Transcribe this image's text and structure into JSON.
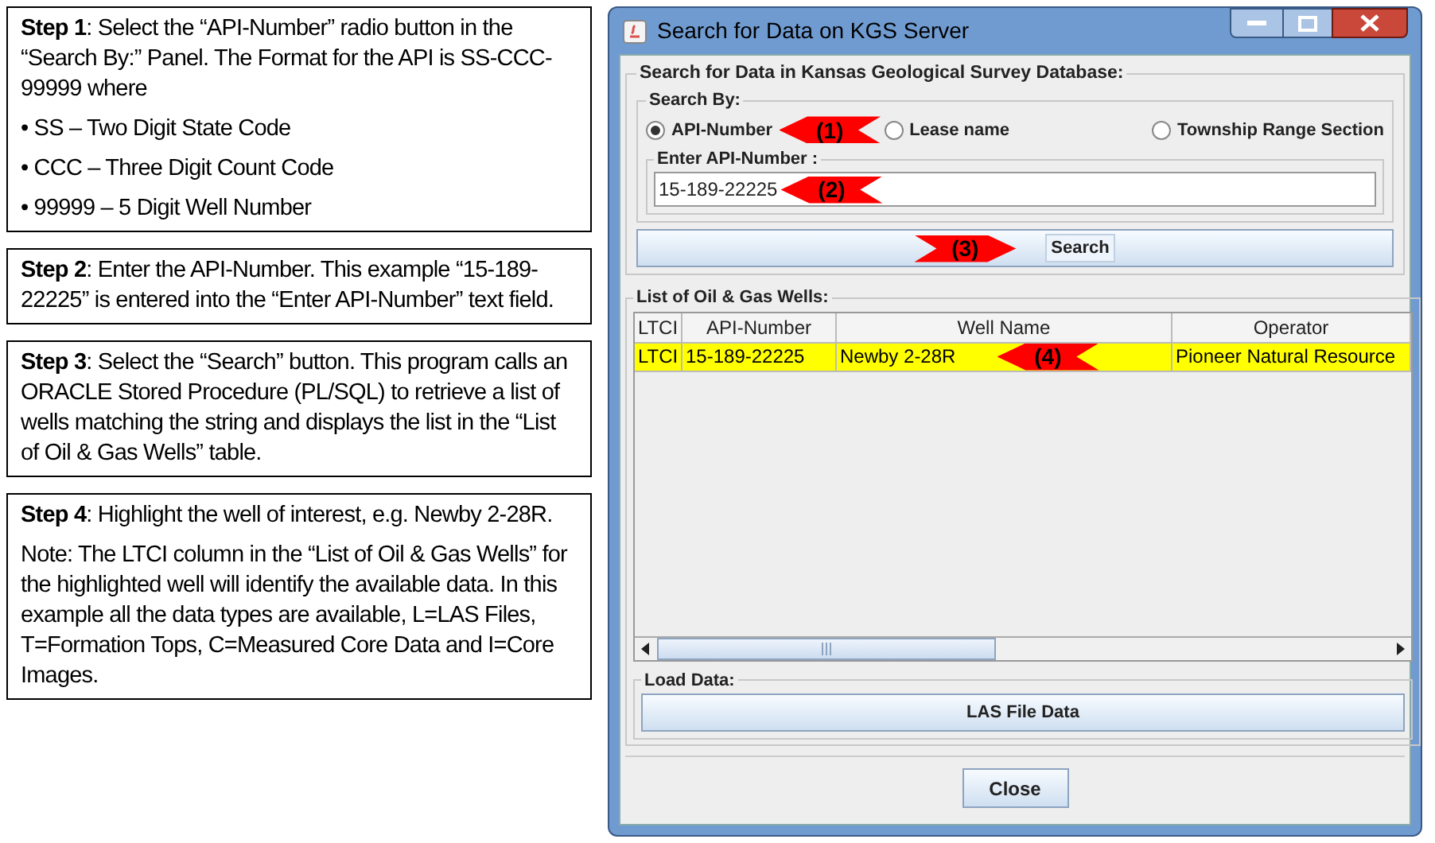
{
  "steps": [
    {
      "paragraphs": [
        "**Step 1**: Select the “API-Number” radio button in the “Search By:” Panel.  The Format for the API is SS-CCC-99999 where",
        "• SS – Two Digit State Code",
        "• CCC – Three Digit Count Code",
        "• 99999 – 5 Digit Well Number"
      ]
    },
    {
      "paragraphs": [
        "**Step 2**: Enter the API-Number. This example “15-189-22225” is entered into the “Enter API-Number” text field."
      ]
    },
    {
      "paragraphs": [
        "**Step 3**: Select the “Search” button.  This program calls an ORACLE Stored Procedure (PL/SQL) to retrieve a list of wells matching the string and displays the list in the “List of Oil & Gas Wells” table."
      ]
    },
    {
      "paragraphs": [
        "**Step 4**: Highlight the well of interest, e.g. Newby 2-28R.",
        "Note: The LTCI column in the “List of Oil & Gas Wells” for the highlighted well will identify the available data. In this example all the data types are available, L=LAS Files, T=Formation Tops, C=Measured Core Data and I=Core Images."
      ]
    }
  ],
  "window": {
    "title": "Search for Data on KGS Server",
    "search_panel": {
      "title": "Search for Data in Kansas Geological Survey Database:",
      "search_by": {
        "title": "Search By:",
        "options": [
          {
            "label": "API-Number",
            "selected": true,
            "marker": {
              "text": "(1)",
              "kind": "left"
            }
          },
          {
            "label": "Lease name",
            "selected": false
          },
          {
            "label": "Township Range Section",
            "selected": false
          }
        ]
      },
      "api_field": {
        "title": "Enter API-Number :",
        "value": "15-189-22225",
        "marker": {
          "text": "(2)",
          "kind": "left"
        }
      },
      "search_button": {
        "label": "Search",
        "marker": {
          "text": "(3)",
          "kind": "right"
        }
      }
    },
    "wells": {
      "title": "List of Oil & Gas Wells:",
      "columns": [
        "LTCI",
        "API-Number",
        "Well Name",
        "Operator"
      ],
      "rows": [
        {
          "cells": [
            "LTCI",
            "15-189-22225",
            "Newby 2-28R",
            "Pioneer Natural Resource"
          ],
          "selected": true,
          "marker": {
            "text": "(4)",
            "kind": "left"
          }
        }
      ]
    },
    "load_data": {
      "title": "Load Data:",
      "button": "LAS File Data"
    },
    "close_button": "Close"
  }
}
